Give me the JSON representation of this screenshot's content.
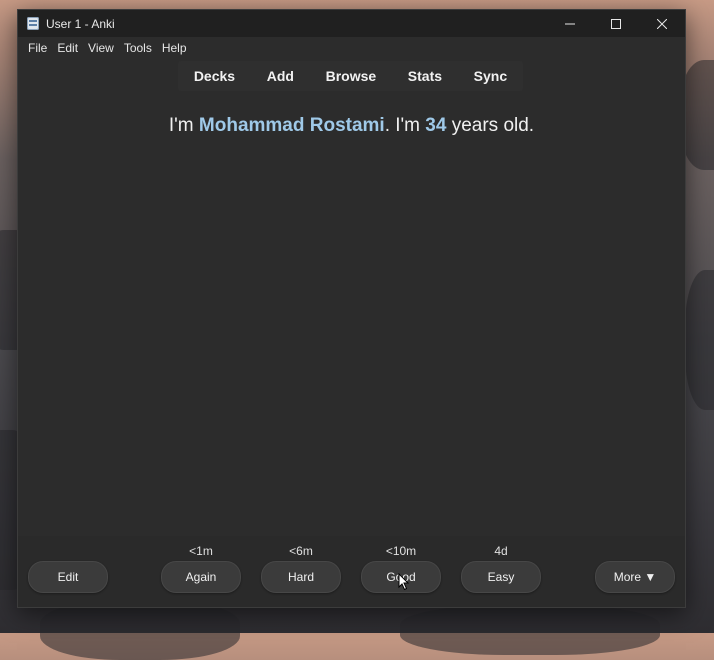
{
  "window": {
    "title": "User 1 - Anki"
  },
  "menu": [
    "File",
    "Edit",
    "View",
    "Tools",
    "Help"
  ],
  "toolbar": [
    "Decks",
    "Add",
    "Browse",
    "Stats",
    "Sync"
  ],
  "card": {
    "prefix": "I'm ",
    "name": "Mohammad Rostami",
    "middle": ". I'm ",
    "age": "34",
    "suffix": " years old."
  },
  "bottom": {
    "edit_label": "Edit",
    "more_label": "More ▼",
    "answers": [
      {
        "label": "Again",
        "interval": "<1m"
      },
      {
        "label": "Hard",
        "interval": "<6m"
      },
      {
        "label": "Good",
        "interval": "<10m"
      },
      {
        "label": "Easy",
        "interval": "4d"
      }
    ]
  },
  "colors": {
    "highlight": "#9fc9e8",
    "window_bg": "#2c2c2c",
    "titlebar_bg": "#202020"
  }
}
